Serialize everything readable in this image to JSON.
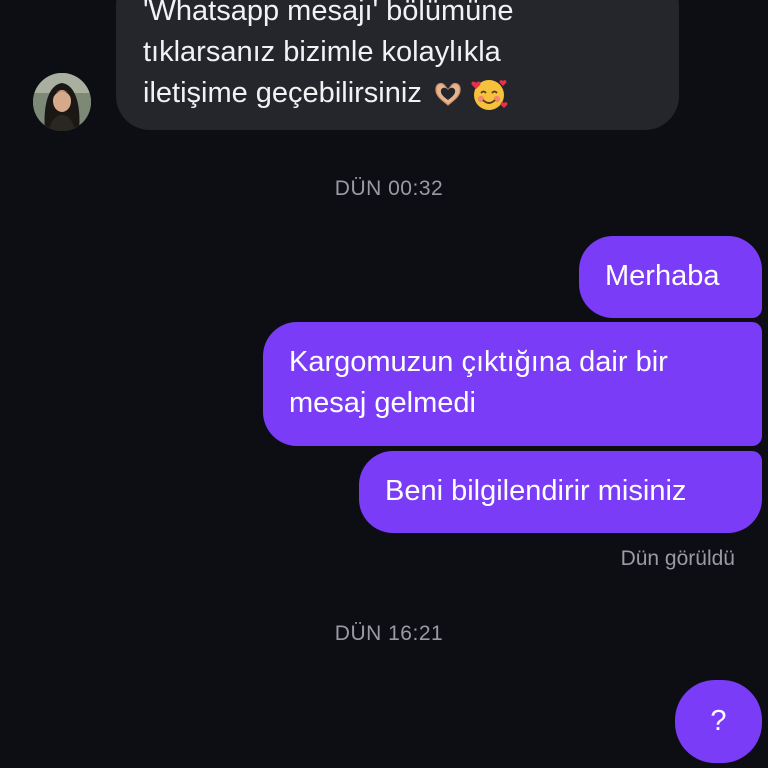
{
  "incoming_message": {
    "line1": "'Whatsapp mesajı' bölümüne",
    "line2": "tıklarsanız bizimle kolaylıkla",
    "line3": "iletişime geçebilirsiniz",
    "emojis": [
      "heart-hands-emoji",
      "smiling-face-with-hearts-emoji"
    ]
  },
  "timestamps": {
    "first": "DÜN 00:32",
    "second": "DÜN 16:21"
  },
  "outgoing_messages": {
    "msg1": "Merhaba",
    "msg2_line1": "Kargomuzun çıktığına dair bir",
    "msg2_line2": "mesaj gelmedi",
    "msg3": "Beni bilgilendirir misiniz",
    "msg4": "?"
  },
  "seen_status": "Dün görüldü",
  "colors": {
    "background": "#0d0e14",
    "incoming_bubble": "#25262c",
    "outgoing_bubble": "#7a3cf7",
    "meta_text": "#9a9ba2"
  }
}
